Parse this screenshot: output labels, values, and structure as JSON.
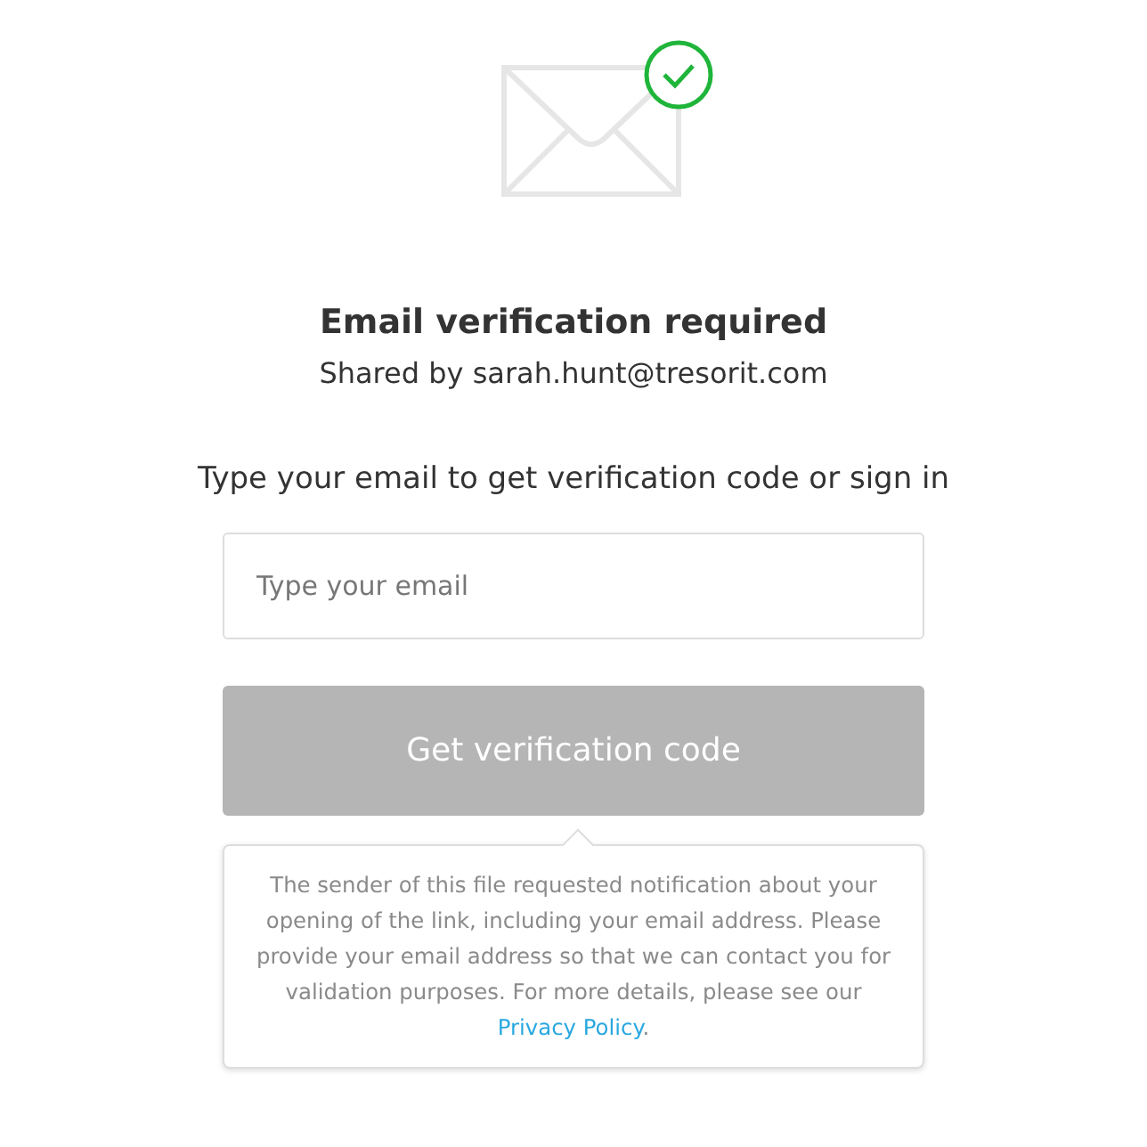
{
  "title": "Email verification required",
  "subtitle": "Shared by sarah.hunt@tresorit.com",
  "prompt": "Type your email to get verification code or sign in",
  "email_field": {
    "placeholder": "Type your email"
  },
  "button": {
    "label": "Get verification code",
    "disabled": true
  },
  "note": {
    "text": "The sender of this file requested notification about your opening of the link, including your email address. Please provide your email address so that we can contact you for validation purposes. For more details, please see our ",
    "link": "Privacy Policy",
    "text_after": "."
  }
}
